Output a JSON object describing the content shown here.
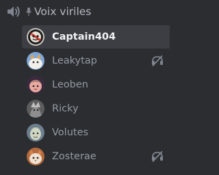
{
  "channel": {
    "name": "Voix viriles",
    "icon": "speaker-icon"
  },
  "members": [
    {
      "name": "Captain404",
      "avatar": "captain404-avatar",
      "active": true,
      "status_icon": ""
    },
    {
      "name": "Leakytap",
      "avatar": "leakytap-avatar",
      "active": false,
      "status_icon": "deafened-icon"
    },
    {
      "name": "Leoben",
      "avatar": "leoben-avatar",
      "active": false,
      "status_icon": ""
    },
    {
      "name": "Ricky",
      "avatar": "ricky-avatar",
      "active": false,
      "status_icon": ""
    },
    {
      "name": "Volutes",
      "avatar": "volutes-avatar",
      "active": false,
      "status_icon": ""
    },
    {
      "name": "Zosterae",
      "avatar": "zosterae-avatar",
      "active": false,
      "status_icon": "deafened-icon"
    }
  ],
  "colors": {
    "background": "#2b2d31",
    "active_row": "#3c3e44",
    "muted_text": "#949ba4",
    "active_text": "#f2f3f5",
    "icon": "#80848e"
  }
}
